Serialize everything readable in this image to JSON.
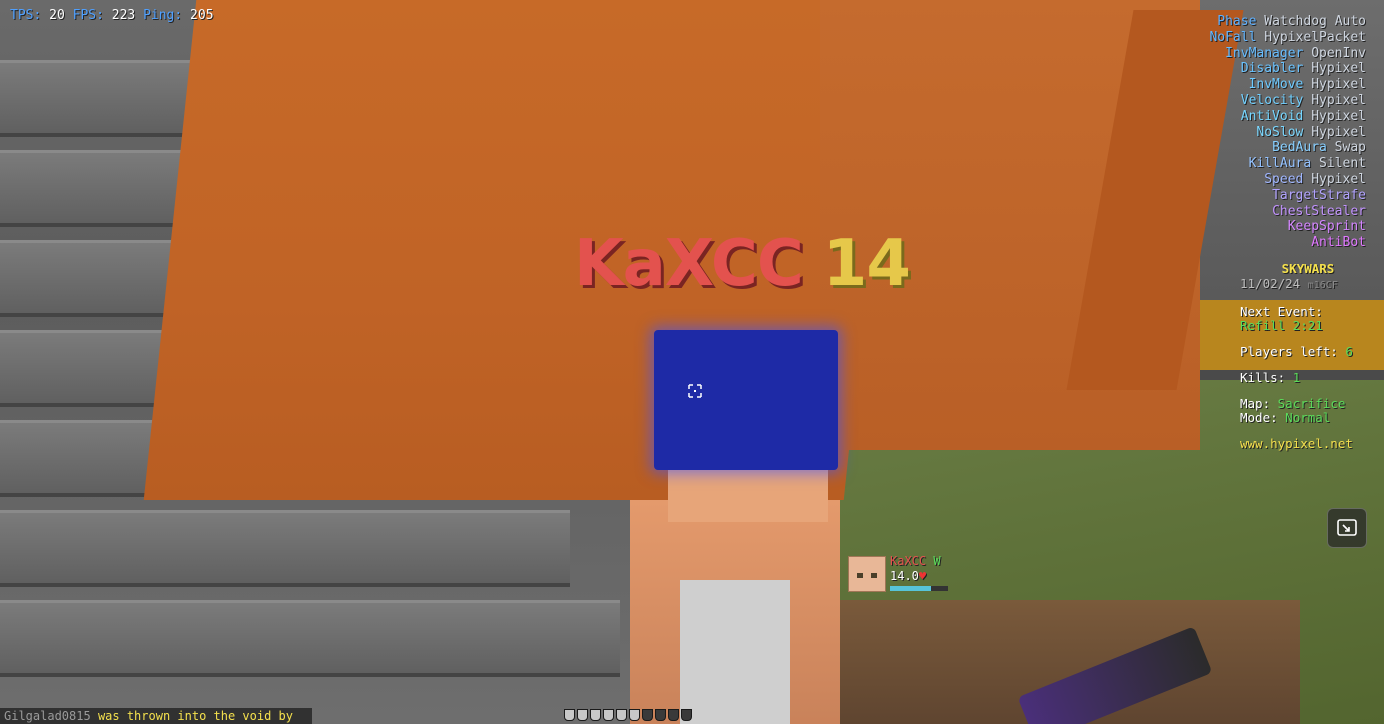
{
  "stats": {
    "tps_label": "TPS:",
    "tps": "20",
    "fps_label": "FPS:",
    "fps": "223",
    "ping_label": "Ping:",
    "ping": "205"
  },
  "modules": [
    {
      "name": "Phase",
      "mode": "Watchdog Auto",
      "color": "#5fb0ff"
    },
    {
      "name": "NoFall",
      "mode": "HypixelPacket",
      "color": "#63b6ff"
    },
    {
      "name": "InvManager",
      "mode": "OpenInv",
      "color": "#66bcff"
    },
    {
      "name": "Disabler",
      "mode": "Hypixel",
      "color": "#6ac3ff"
    },
    {
      "name": "InvMove",
      "mode": "Hypixel",
      "color": "#6ecaff"
    },
    {
      "name": "Velocity",
      "mode": "Hypixel",
      "color": "#72d0ff"
    },
    {
      "name": "AntiVoid",
      "mode": "Hypixel",
      "color": "#76d6ff"
    },
    {
      "name": "NoSlow",
      "mode": "Hypixel",
      "color": "#7cd8ff"
    },
    {
      "name": "BedAura",
      "mode": "Swap",
      "color": "#88cfff"
    },
    {
      "name": "KillAura",
      "mode": "Silent",
      "color": "#94c2ff"
    },
    {
      "name": "Speed",
      "mode": "Hypixel",
      "color": "#a0b6ff"
    },
    {
      "name": "TargetStrafe",
      "mode": "",
      "color": "#b2a4ff"
    },
    {
      "name": "ChestStealer",
      "mode": "",
      "color": "#c394ff"
    },
    {
      "name": "KeepSprint",
      "mode": "",
      "color": "#d486ff"
    },
    {
      "name": "AntiBot",
      "mode": "",
      "color": "#e078ff"
    }
  ],
  "nametag": {
    "name": "KaXCC",
    "level": "14"
  },
  "scoreboard": {
    "title": "SKYWARS",
    "date": "11/02/24",
    "server": "m16CF",
    "next_event_label": "Next Event:",
    "next_event": "Refill 2:21",
    "players_left_label": "Players left:",
    "players_left": "6",
    "kills_label": "Kills:",
    "kills": "1",
    "map_label": "Map:",
    "map": "Sacrifice",
    "mode_label": "Mode:",
    "mode": "Normal",
    "website": "www.hypixel.net"
  },
  "target": {
    "name": "KaXCC",
    "result": "W",
    "health": "14.0",
    "health_fraction": 0.7
  },
  "chat": {
    "player": "Gilgalad0815",
    "message": "was thrown into the void by"
  },
  "armor": {
    "full": 6,
    "total": 10
  },
  "icons": {
    "pip": "picture-in-picture-icon",
    "crosshair": "crosshair-icon",
    "heart": "heart-icon"
  }
}
